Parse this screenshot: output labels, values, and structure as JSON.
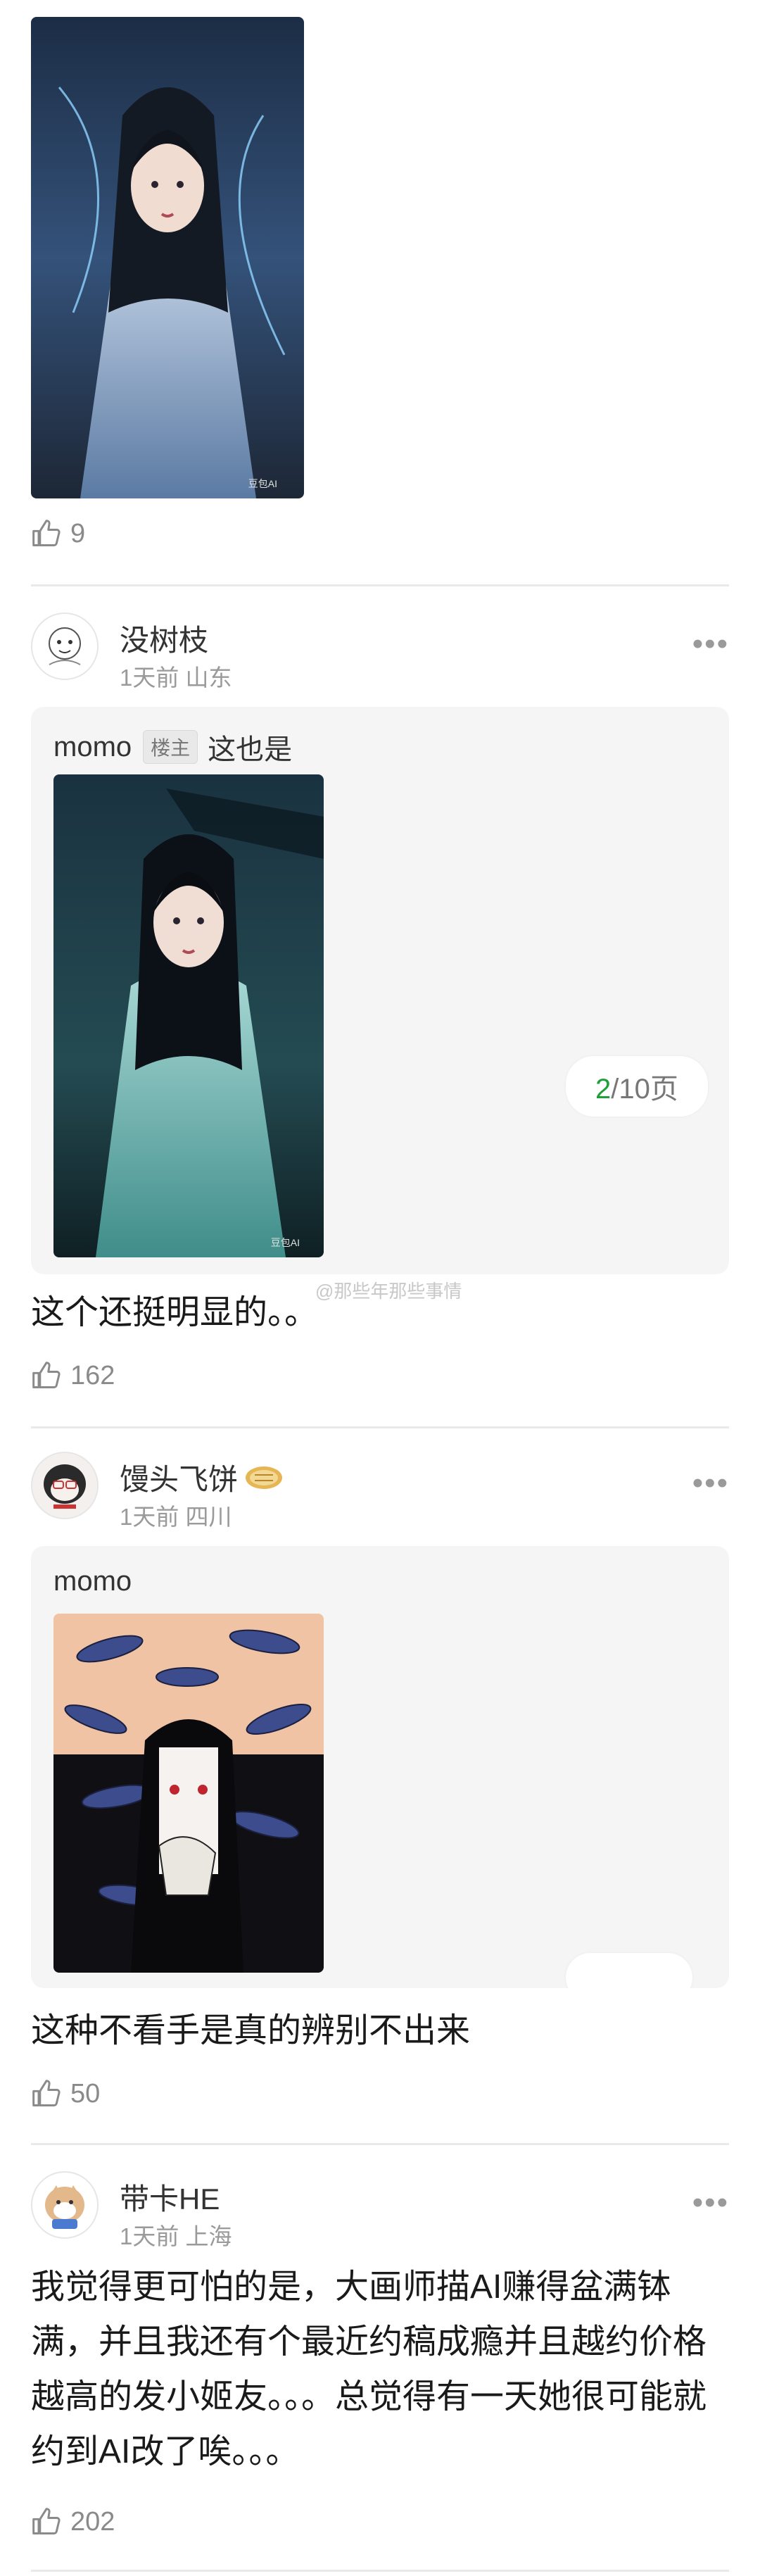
{
  "top_post": {
    "image_label": "豆包AI",
    "likes": "9"
  },
  "comments": [
    {
      "username": "没树枝",
      "time": "1天前",
      "location": "山东",
      "quote_author": "momo",
      "quote_badge": "楼主",
      "quote_text": "这也是",
      "image_label": "豆包AI",
      "pager_current": "2",
      "pager_total": "/10页",
      "text": "这个还挺明显的。。",
      "likes": "162"
    },
    {
      "username": "馒头飞饼",
      "time": "1天前",
      "location": "四川",
      "quote_author": "momo",
      "text": "这种不看手是真的辨别不出来",
      "likes": "50"
    },
    {
      "username": "带卡HE",
      "time": "1天前",
      "location": "上海",
      "text": "我觉得更可怕的是，大画师描AI赚得盆满钵满，并且我还有个最近约稿成瘾并且越约价格越高的发小姬友。。。总觉得有一天她很可能就约到AI改了唉。。。",
      "likes": "202"
    }
  ],
  "watermark": "@那些年那些事情",
  "icons": {
    "like": "thumbs-up-icon",
    "more": "more-dots-icon"
  },
  "colors": {
    "pager_green": "#1e9f3a",
    "divider": "#e9e9e9",
    "quote_bg": "#f5f5f5"
  }
}
